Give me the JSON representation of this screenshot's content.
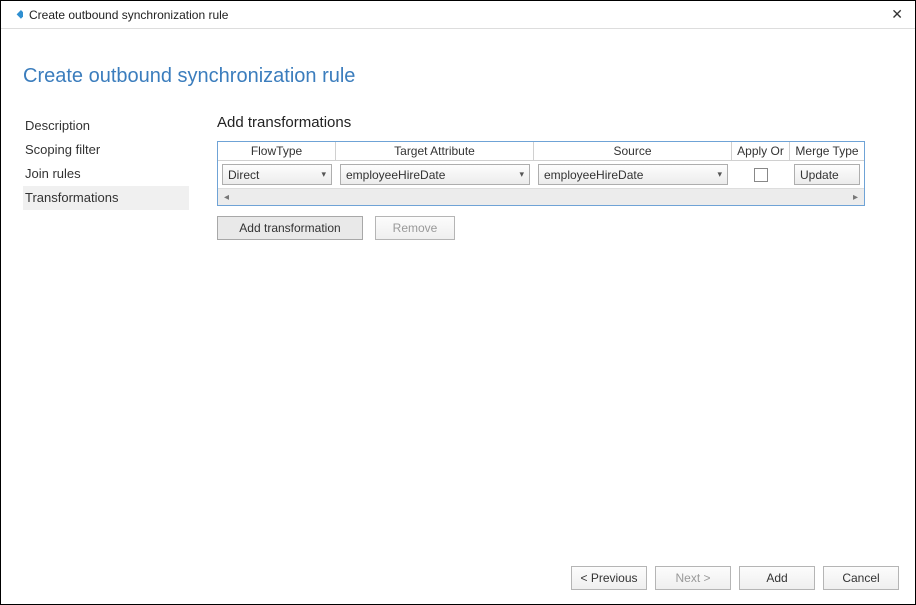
{
  "window": {
    "title": "Create outbound synchronization rule"
  },
  "page": {
    "title": "Create outbound synchronization rule"
  },
  "sidebar": {
    "items": [
      {
        "label": "Description",
        "active": false
      },
      {
        "label": "Scoping filter",
        "active": false
      },
      {
        "label": "Join rules",
        "active": false
      },
      {
        "label": "Transformations",
        "active": true
      }
    ]
  },
  "section": {
    "title": "Add transformations"
  },
  "grid": {
    "headers": {
      "flowtype": "FlowType",
      "target": "Target Attribute",
      "source": "Source",
      "applyor": "Apply Or",
      "mergetype": "Merge Type"
    },
    "rows": [
      {
        "flowtype": "Direct",
        "target": "employeeHireDate",
        "source": "employeeHireDate",
        "applyor": false,
        "mergetype": "Update"
      }
    ]
  },
  "buttons": {
    "add_transformation": "Add transformation",
    "remove": "Remove"
  },
  "footer": {
    "previous": "< Previous",
    "next": "Next >",
    "add": "Add",
    "cancel": "Cancel"
  }
}
